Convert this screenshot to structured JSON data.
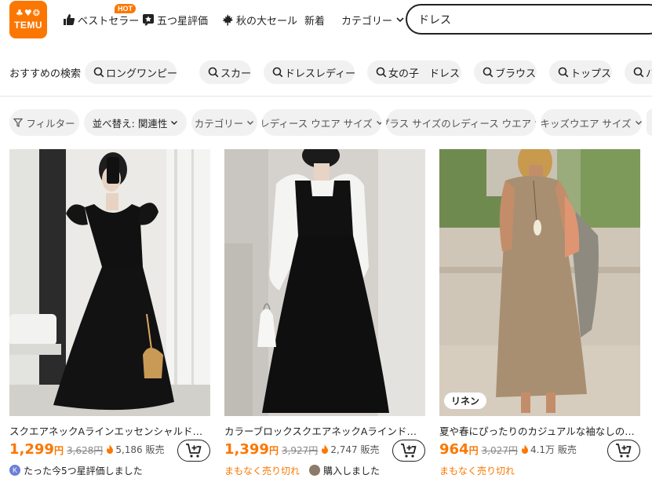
{
  "header": {
    "logo_text": "TEMU",
    "nav": {
      "best_sellers": "ベストセラー",
      "hot_badge": "HOT",
      "five_star": "五つ星評価",
      "autumn_sale": "秋の大セール",
      "new_arrivals": "新着",
      "category": "カテゴリー"
    },
    "search_value": "ドレス"
  },
  "recommended": {
    "label": "おすすめの検索",
    "chips": [
      "ロングワンピース",
      "スカート",
      "ドレスレディース",
      "女の子　ドレス",
      "ブラウス",
      "トップス",
      "ハ"
    ]
  },
  "filters": {
    "filter": "フィルター",
    "sort": "並べ替え: 関連性",
    "category": "カテゴリー",
    "ladies_size": "レディース ウエア サイズ",
    "plus_size": "プラス サイズのレディース ウエア",
    "kids_size": "キッズウエア サイズ"
  },
  "products": [
    {
      "title": "スクエアネックAラインエッセンシャルドレス、春…",
      "price": "1,299",
      "currency": "円",
      "original": "3,628円",
      "sold": "5,186 販売",
      "sub": "たった今5つ星評価しました",
      "avatar_letter": "K"
    },
    {
      "title": "カラーブロックスクエアネックAラインドレス、春と…",
      "price": "1,399",
      "currency": "円",
      "original": "3,927円",
      "sold": "2,747 販売",
      "sub": "まもなく売り切れ",
      "sub2": "購入しました"
    },
    {
      "title": "夏や春にぴったりのカジュアルな袖なしのソリッ…",
      "price": "964",
      "currency": "円",
      "original": "3,027円",
      "sold": "4.1万 販売",
      "sub": "まもなく売り切れ",
      "badge": "リネン"
    }
  ],
  "colors": {
    "brand": "#fb7701",
    "text": "#222222",
    "chip_bg": "#f1f1f1"
  }
}
